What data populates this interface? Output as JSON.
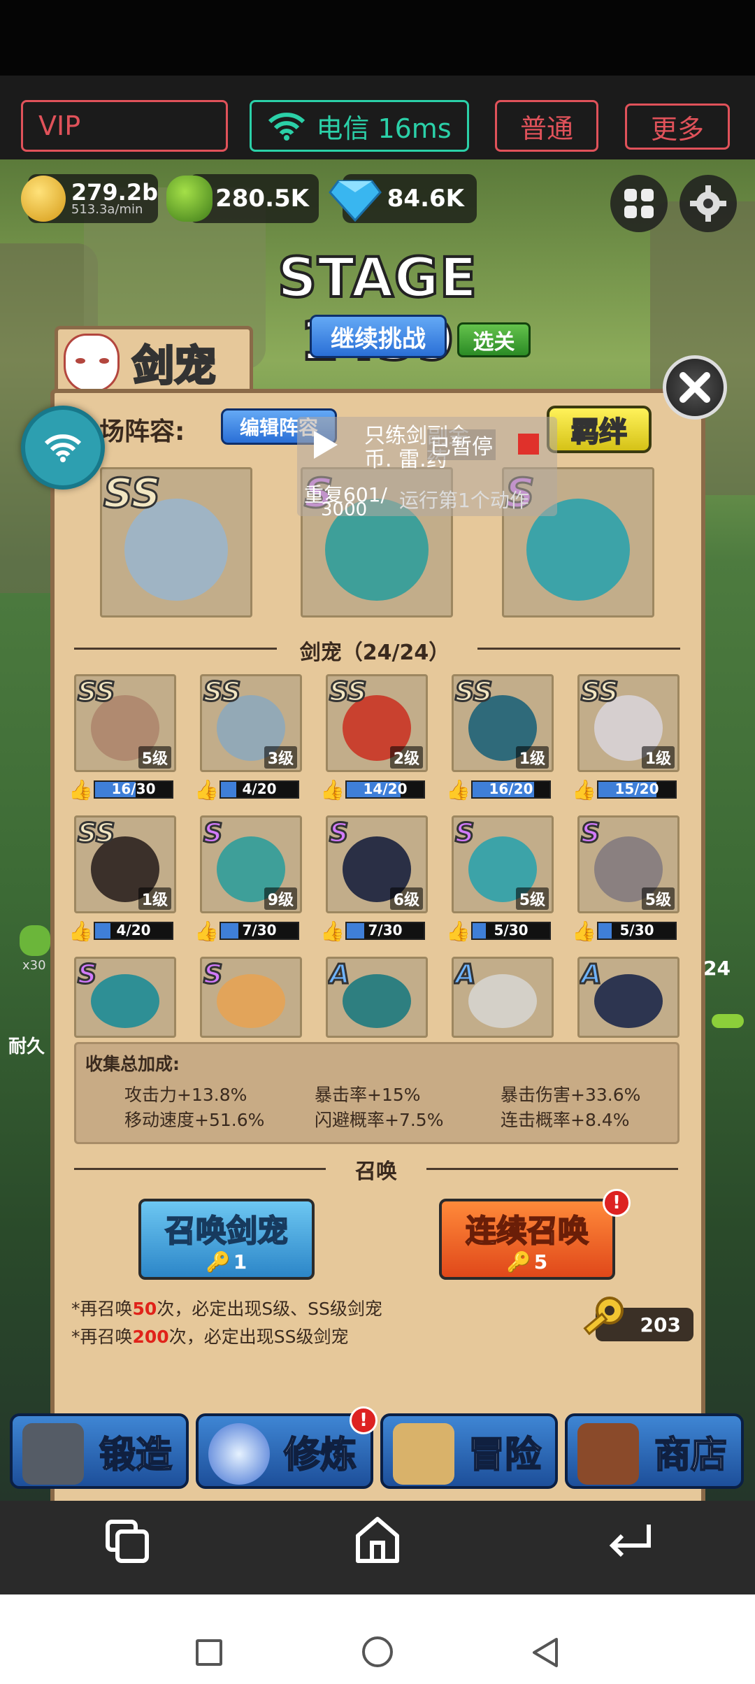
{
  "stream_bar": {
    "vip_label": "VIP",
    "network_label": "电信 16ms",
    "quality_label": "普通",
    "more_label": "更多"
  },
  "resources": {
    "gold_value": "279.2b",
    "gold_rate": "513.3a/min",
    "ore_value": "280.5K",
    "gem_value": "84.6K"
  },
  "stage": {
    "title": "STAGE 1439",
    "continue_label": "继续挑战",
    "select_label": "选关"
  },
  "panel": {
    "tab_title": "剑宠",
    "lineup_label": "场阵容:",
    "edit_lineup_label": "编辑阵容",
    "bond_label": "羁绊",
    "overlay_text_1": "只练剑副金",
    "overlay_text_2": "币. 雷.药",
    "overlay_paused": "已暂停",
    "overlay_repeat": "重复601/",
    "overlay_repeat_2": "3000",
    "overlay_running": "运行第1个动作",
    "collection_title": "剑宠（24/24）",
    "lineup": [
      {
        "grade": "SS",
        "color": "#9fb4c4"
      },
      {
        "grade": "S",
        "color": "#3e9f99"
      },
      {
        "grade": "S",
        "color": "#3ca3a8"
      }
    ],
    "pets_row1": [
      {
        "grade": "SS",
        "level": "5级",
        "progress": "16/30",
        "ratio": 0.53,
        "color": "#b08a70"
      },
      {
        "grade": "SS",
        "level": "3级",
        "progress": "4/20",
        "ratio": 0.2,
        "color": "#93a9b6"
      },
      {
        "grade": "SS",
        "level": "2级",
        "progress": "14/20",
        "ratio": 0.7,
        "color": "#c9412f"
      },
      {
        "grade": "SS",
        "level": "1级",
        "progress": "16/20",
        "ratio": 0.8,
        "color": "#2f6a7a"
      },
      {
        "grade": "SS",
        "level": "1级",
        "progress": "15/20",
        "ratio": 0.75,
        "color": "#d6cfcf"
      }
    ],
    "pets_row2": [
      {
        "grade": "SS",
        "level": "1级",
        "progress": "4/20",
        "ratio": 0.2,
        "color": "#3b302a"
      },
      {
        "grade": "S",
        "level": "9级",
        "progress": "7/30",
        "ratio": 0.23,
        "color": "#3e9f99"
      },
      {
        "grade": "S",
        "level": "6级",
        "progress": "7/30",
        "ratio": 0.23,
        "color": "#2a2f45"
      },
      {
        "grade": "S",
        "level": "5级",
        "progress": "5/30",
        "ratio": 0.17,
        "color": "#3ca3a8"
      },
      {
        "grade": "S",
        "level": "5级",
        "progress": "5/30",
        "ratio": 0.17,
        "color": "#8a8080"
      }
    ],
    "pets_row3": [
      {
        "grade": "S",
        "color": "#2e8f95"
      },
      {
        "grade": "S",
        "color": "#e2a45a"
      },
      {
        "grade": "A",
        "color": "#2e7f80"
      },
      {
        "grade": "A",
        "color": "#d4d0c8"
      },
      {
        "grade": "A",
        "color": "#2d3550"
      }
    ],
    "bonus_title": "收集总加成:",
    "bonuses": [
      "攻击力+13.8%",
      "暴击率+15%",
      "暴击伤害+33.6%",
      "移动速度+51.6%",
      "闪避概率+7.5%",
      "连击概率+8.4%"
    ],
    "summon_title": "召唤",
    "summon_label": "召唤剑宠",
    "summon_cost": "1",
    "multi_summon_label": "连续召唤",
    "multi_summon_cost": "5",
    "summon_badge": "!",
    "note1_pre": "*再召唤",
    "note1_num": "50",
    "note1_post": "次，必定出现S级、SS级剑宠",
    "note2_pre": "*再召唤",
    "note2_num": "200",
    "note2_post": "次，必定出现SS级剑宠",
    "keys": "203"
  },
  "side": {
    "left_count": "x30",
    "left_label": "耐久",
    "right_count": "24"
  },
  "bottom_nav": {
    "forge": "锻造",
    "cultivate": "修炼",
    "adventure": "冒险",
    "shop": "商店",
    "cultivate_badge": "!"
  }
}
